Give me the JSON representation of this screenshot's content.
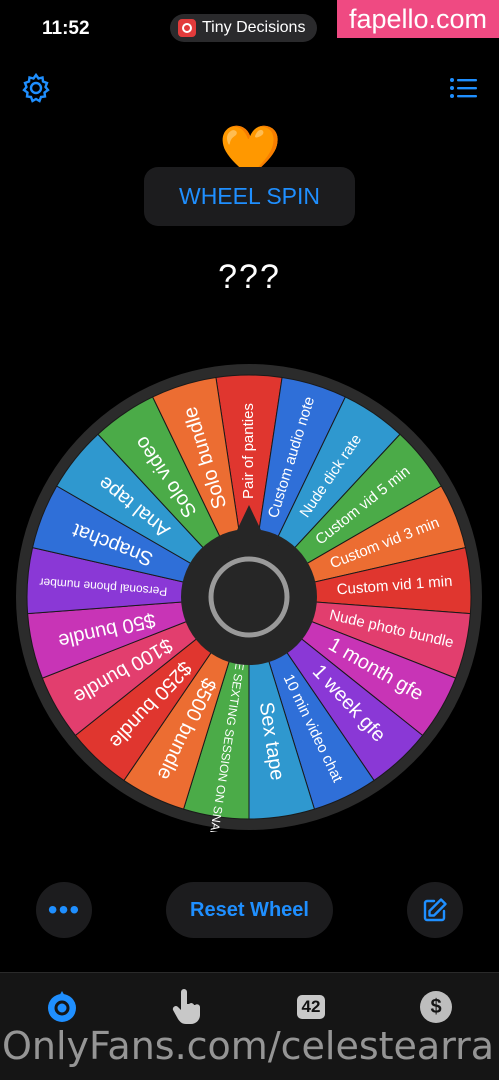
{
  "status_bar": {
    "time": "11:52"
  },
  "app_pill": {
    "label": "Tiny Decisions",
    "icon": "app-icon"
  },
  "watermark_top": "fapello.com",
  "header": {
    "settings_icon": "gear-icon",
    "list_icon": "list-icon"
  },
  "emoji": "🧡",
  "title": "WHEEL SPIN",
  "result": "???",
  "wheel": {
    "segments": [
      {
        "label": "Pair of panties",
        "color": "#e0362f"
      },
      {
        "label": "Custom audio note",
        "color": "#2f6fd8"
      },
      {
        "label": "Nude dick rate",
        "color": "#2f98cf"
      },
      {
        "label": "Custom vid 5 min",
        "color": "#4bab48"
      },
      {
        "label": "Custom vid 3 min",
        "color": "#ec6d32"
      },
      {
        "label": "Custom vid 1 min",
        "color": "#e0362f"
      },
      {
        "label": "Nude photo bundle",
        "color": "#e23e6e"
      },
      {
        "label": "1 month gfe",
        "color": "#c834b6"
      },
      {
        "label": "1 week gfe",
        "color": "#8a38d6"
      },
      {
        "label": "10 min video chat",
        "color": "#2f6fd8"
      },
      {
        "label": "Sex tape",
        "color": "#2f98cf"
      },
      {
        "label": "LIVE SEXTING SESSION ON SNAP",
        "color": "#4bab48"
      },
      {
        "label": "$500 bundle",
        "color": "#ec6d32"
      },
      {
        "label": "$250 bundle",
        "color": "#e0362f"
      },
      {
        "label": "$100 bundle",
        "color": "#e23e6e"
      },
      {
        "label": "$50 bundle",
        "color": "#c834b6"
      },
      {
        "label": "Personal phone number",
        "color": "#8a38d6"
      },
      {
        "label": "Snapchat",
        "color": "#2f6fd8"
      },
      {
        "label": "Anal tape",
        "color": "#2f98cf"
      },
      {
        "label": "Solo video",
        "color": "#4bab48"
      },
      {
        "label": "Solo bundle",
        "color": "#ec6d32"
      }
    ]
  },
  "buttons": {
    "more": "•••",
    "reset": "Reset Wheel",
    "edit_icon": "edit-icon"
  },
  "tabbar": {
    "count": "42",
    "dollar": "$"
  },
  "watermark_bottom": "OnlyFans.com/celestearra"
}
